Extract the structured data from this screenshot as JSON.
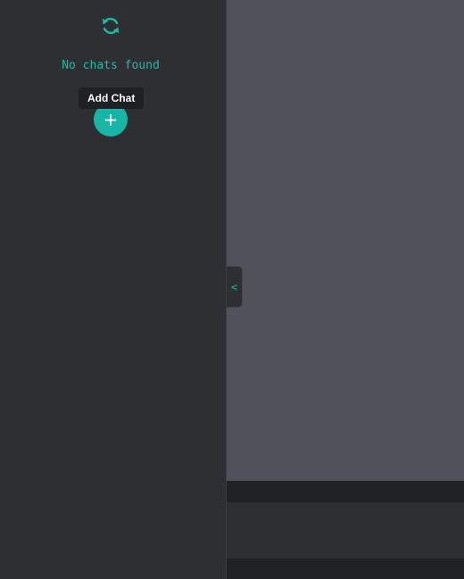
{
  "sidebar": {
    "refresh_icon": "refresh-icon",
    "empty_message": "No chats found",
    "add_chat_icon": "plus-icon",
    "add_chat_tooltip": "Add Chat",
    "add_chat_symbol": "+"
  },
  "main": {
    "collapse_symbol": "<"
  },
  "colors": {
    "accent": "#17b5a5",
    "sidebar_bg": "#2e2f33",
    "main_bg": "#4f525b",
    "tooltip_bg": "#1f2023"
  }
}
